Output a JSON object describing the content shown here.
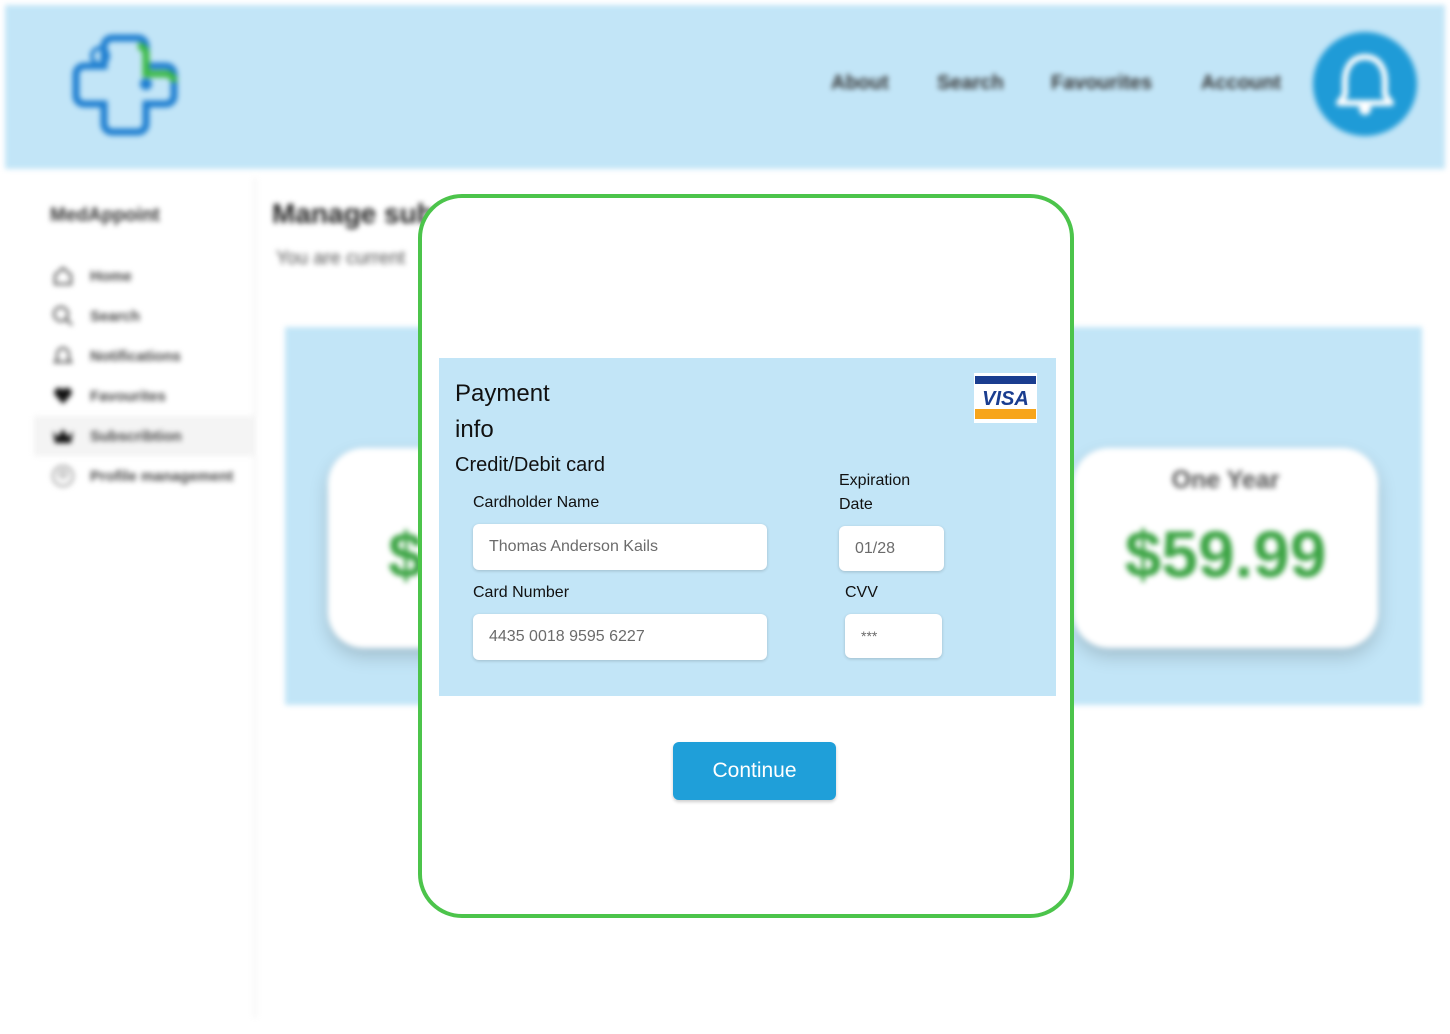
{
  "header": {
    "nav": [
      "About",
      "Search",
      "Favourites",
      "Account"
    ]
  },
  "sidebar": {
    "brand": "MedAppoint",
    "items": [
      {
        "label": "Home",
        "icon": "home-icon"
      },
      {
        "label": "Search",
        "icon": "search-icon"
      },
      {
        "label": "Notifications",
        "icon": "bell-icon"
      },
      {
        "label": "Favourites",
        "icon": "heart-icon"
      },
      {
        "label": "Subscribtion",
        "icon": "crown-icon",
        "active": true
      },
      {
        "label": "Profile management",
        "icon": "user-icon"
      }
    ]
  },
  "main": {
    "title": "Manage sub",
    "subtitle": "You are current",
    "plans": [
      {
        "label": "",
        "price": "$"
      },
      {
        "label": "One Year",
        "price": "$59.99"
      }
    ]
  },
  "modal": {
    "title": "Payment info",
    "card_type_label": "Credit/Debit card",
    "card_brand": "VISA",
    "cardholder_label": "Cardholder Name",
    "cardholder_value": "Thomas Anderson Kails",
    "card_number_label": "Card Number",
    "card_number_value": "4435 0018 9595 6227",
    "expiration_label": "Expiration Date",
    "expiration_value": "01/28",
    "cvv_label": "CVV",
    "cvv_value": "***",
    "continue_label": "Continue"
  },
  "colors": {
    "accent": "#1f9fd9",
    "panel": "#c2e5f7",
    "modal_border": "#4cc44b",
    "price": "#3ca444"
  }
}
